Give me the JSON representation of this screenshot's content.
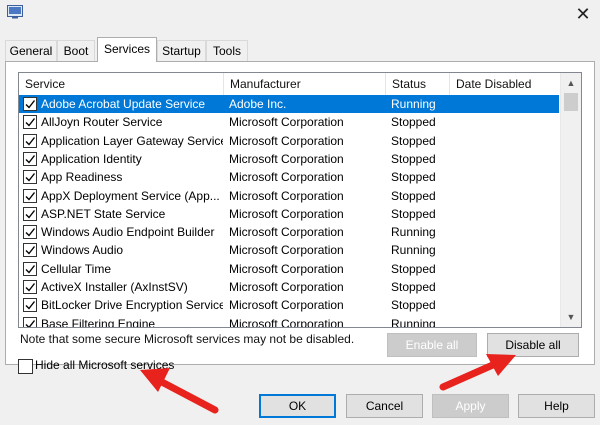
{
  "window": {
    "close_glyph": "✕"
  },
  "tabs": [
    {
      "label": "General"
    },
    {
      "label": "Boot"
    },
    {
      "label": "Services"
    },
    {
      "label": "Startup"
    },
    {
      "label": "Tools"
    }
  ],
  "active_tab": "Services",
  "table": {
    "headers": {
      "service": "Service",
      "manufacturer": "Manufacturer",
      "status": "Status",
      "date_disabled": "Date Disabled"
    },
    "rows": [
      {
        "service": "Adobe Acrobat Update Service",
        "manufacturer": "Adobe Inc.",
        "status": "Running",
        "date_disabled": "",
        "checked": true,
        "selected": true
      },
      {
        "service": "AllJoyn Router Service",
        "manufacturer": "Microsoft Corporation",
        "status": "Stopped",
        "date_disabled": "",
        "checked": true
      },
      {
        "service": "Application Layer Gateway Service",
        "manufacturer": "Microsoft Corporation",
        "status": "Stopped",
        "date_disabled": "",
        "checked": true
      },
      {
        "service": "Application Identity",
        "manufacturer": "Microsoft Corporation",
        "status": "Stopped",
        "date_disabled": "",
        "checked": true
      },
      {
        "service": "App Readiness",
        "manufacturer": "Microsoft Corporation",
        "status": "Stopped",
        "date_disabled": "",
        "checked": true
      },
      {
        "service": "AppX Deployment Service (App...",
        "manufacturer": "Microsoft Corporation",
        "status": "Stopped",
        "date_disabled": "",
        "checked": true
      },
      {
        "service": "ASP.NET State Service",
        "manufacturer": "Microsoft Corporation",
        "status": "Stopped",
        "date_disabled": "",
        "checked": true
      },
      {
        "service": "Windows Audio Endpoint Builder",
        "manufacturer": "Microsoft Corporation",
        "status": "Running",
        "date_disabled": "",
        "checked": true
      },
      {
        "service": "Windows Audio",
        "manufacturer": "Microsoft Corporation",
        "status": "Running",
        "date_disabled": "",
        "checked": true
      },
      {
        "service": "Cellular Time",
        "manufacturer": "Microsoft Corporation",
        "status": "Stopped",
        "date_disabled": "",
        "checked": true
      },
      {
        "service": "ActiveX Installer (AxInstSV)",
        "manufacturer": "Microsoft Corporation",
        "status": "Stopped",
        "date_disabled": "",
        "checked": true
      },
      {
        "service": "BitLocker Drive Encryption Service",
        "manufacturer": "Microsoft Corporation",
        "status": "Stopped",
        "date_disabled": "",
        "checked": true
      },
      {
        "service": "Base Filtering Engine",
        "manufacturer": "Microsoft Corporation",
        "status": "Running",
        "date_disabled": "",
        "checked": true
      }
    ]
  },
  "note": "Note that some secure Microsoft services may not be disabled.",
  "buttons": {
    "enable_all": "Enable all",
    "disable_all": "Disable all",
    "ok": "OK",
    "cancel": "Cancel",
    "apply": "Apply",
    "help": "Help"
  },
  "hide_microsoft": {
    "label": "Hide all Microsoft services",
    "checked": false
  },
  "colors": {
    "selection": "#0078d7",
    "annotation_arrow": "#e8221c"
  }
}
